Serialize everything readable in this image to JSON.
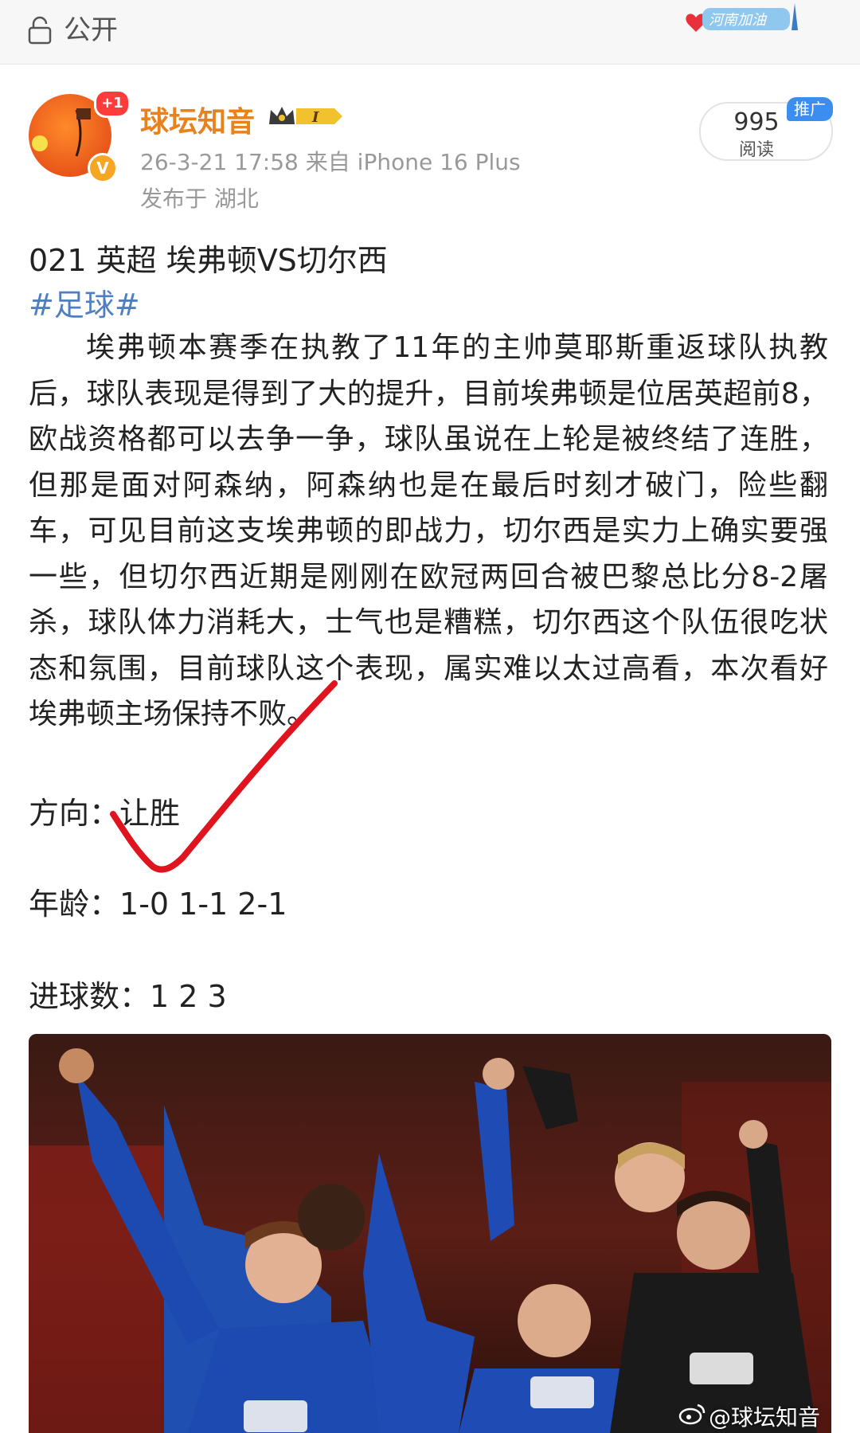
{
  "topbar": {
    "visibility_label": "公开",
    "banner_text": "河南加油"
  },
  "post": {
    "author": {
      "name": "球坛知音",
      "avatar_badge": "+1",
      "verified_mark": "V",
      "rank_badge": "I"
    },
    "meta": "26-3-21 17:58  来自 iPhone 16 Plus",
    "location": "发布于 湖北",
    "reads": {
      "count": "995",
      "label": "阅读",
      "promo_tag": "推广"
    },
    "title": "021 英超 埃弗顿VS切尔西",
    "hashtag": "#足球#",
    "body": "埃弗顿本赛季在执教了11年的主帅莫耶斯重返球队执教后，球队表现是得到了大的提升，目前埃弗顿是位居英超前8，欧战资格都可以去争一争，球队虽说在上轮是被终结了连胜，但那是面对阿森纳，阿森纳也是在最后时刻才破门，险些翻车，可见目前这支埃弗顿的即战力，切尔西是实力上确实要强一些，但切尔西近期是刚刚在欧冠两回合被巴黎总比分8-2屠杀，球队体力消耗大，士气也是糟糕，切尔西这个队伍很吃状态和氛围，目前球队这个表现，属实难以太过高看，本次看好埃弗顿主场保持不败。",
    "fields": [
      {
        "label": "方向：",
        "value": "让胜"
      },
      {
        "label": "年龄：",
        "value": "1-0 1-1 2-1"
      },
      {
        "label": "进球数：",
        "value": "1 2 3"
      }
    ],
    "watermark": "@球坛知音"
  },
  "colors": {
    "username": "#e8821e",
    "hashtag": "#4f7fc0",
    "checkmark": "#e0141e",
    "promo_tag": "#3b8ef0"
  }
}
